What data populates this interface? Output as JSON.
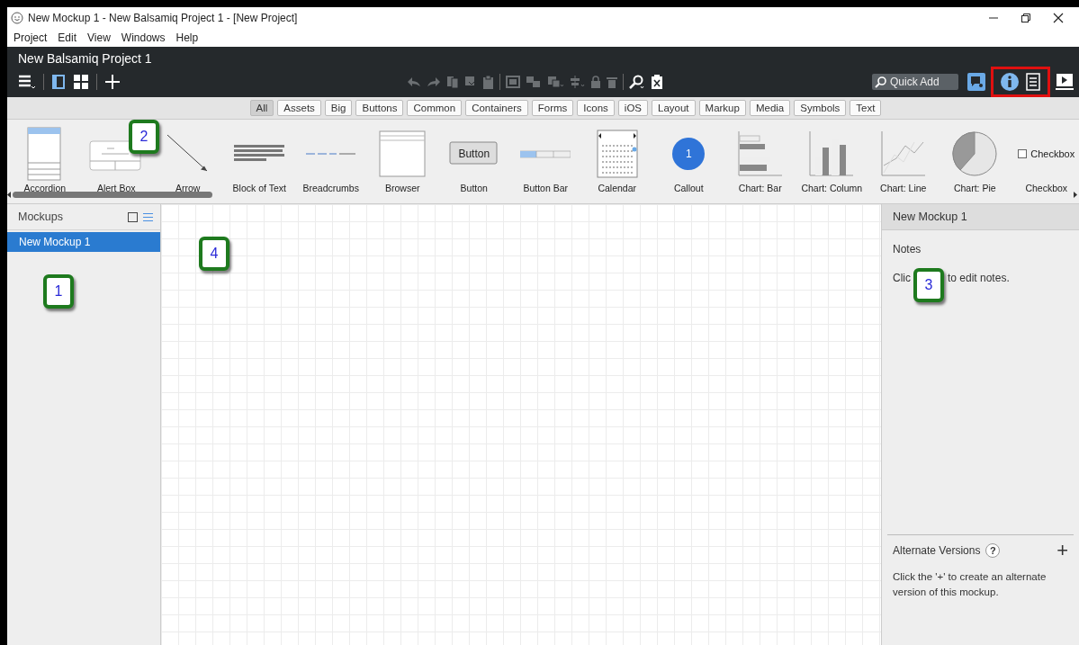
{
  "window": {
    "title": "New Mockup 1 - New Balsamiq Project 1 - [New Project]",
    "controls": [
      {
        "kind": "minimize"
      },
      {
        "kind": "restore"
      },
      {
        "kind": "close"
      }
    ]
  },
  "menu": [
    "Project",
    "Edit",
    "View",
    "Windows",
    "Help"
  ],
  "project_title": "New Balsamiq Project 1",
  "toolbar": {
    "left": [
      {
        "kind": "menu",
        "selected": false
      },
      {
        "kind": "single-pane",
        "selected": true
      },
      {
        "kind": "grid",
        "selected": false
      },
      {
        "kind": "add",
        "selected": false
      }
    ],
    "center": [
      {
        "kind": "undo",
        "disabled": true
      },
      {
        "kind": "redo",
        "disabled": true
      },
      {
        "kind": "copy",
        "disabled": true
      },
      {
        "kind": "cut",
        "disabled": true
      },
      {
        "kind": "paste",
        "disabled": true
      },
      {
        "kind": "group",
        "disabled": true
      },
      {
        "kind": "ungroup",
        "disabled": true
      },
      {
        "kind": "arrange",
        "disabled": true
      },
      {
        "kind": "align",
        "disabled": true
      },
      {
        "kind": "lock",
        "disabled": true
      },
      {
        "kind": "trash",
        "disabled": true
      },
      {
        "kind": "search",
        "disabled": false
      },
      {
        "kind": "clear",
        "disabled": false
      }
    ],
    "quick_add": {
      "placeholder": "Quick Add"
    },
    "right": [
      {
        "kind": "feedback",
        "selected": false
      },
      {
        "kind": "highlight-frame",
        "items": [
          {
            "kind": "info",
            "selected": true
          },
          {
            "kind": "notes",
            "selected": false
          }
        ]
      },
      {
        "kind": "present",
        "selected": false
      }
    ]
  },
  "filters": [
    {
      "label": "All",
      "selected": true
    },
    {
      "label": "Assets",
      "selected": false
    },
    {
      "label": "Big",
      "selected": false
    },
    {
      "label": "Buttons",
      "selected": false
    },
    {
      "label": "Common",
      "selected": false
    },
    {
      "label": "Containers",
      "selected": false
    },
    {
      "label": "Forms",
      "selected": false
    },
    {
      "label": "Icons",
      "selected": false
    },
    {
      "label": "iOS",
      "selected": false
    },
    {
      "label": "Layout",
      "selected": false
    },
    {
      "label": "Markup",
      "selected": false
    },
    {
      "label": "Media",
      "selected": false
    },
    {
      "label": "Symbols",
      "selected": false
    },
    {
      "label": "Text",
      "selected": false
    }
  ],
  "library": [
    {
      "label": "Accordion",
      "kind": "accordion"
    },
    {
      "label": "Alert Box",
      "kind": "alert"
    },
    {
      "label": "Arrow",
      "kind": "arrow"
    },
    {
      "label": "Block of Text",
      "kind": "text-block"
    },
    {
      "label": "Breadcrumbs",
      "kind": "breadcrumbs"
    },
    {
      "label": "Browser",
      "kind": "browser"
    },
    {
      "label": "Button",
      "kind": "button",
      "text": "Button"
    },
    {
      "label": "Button Bar",
      "kind": "button-bar"
    },
    {
      "label": "Calendar",
      "kind": "calendar"
    },
    {
      "label": "Callout",
      "kind": "callout",
      "text": "1"
    },
    {
      "label": "Chart: Bar",
      "kind": "bar-chart"
    },
    {
      "label": "Chart: Column",
      "kind": "column-chart"
    },
    {
      "label": "Chart: Line",
      "kind": "line-chart"
    },
    {
      "label": "Chart: Pie",
      "kind": "pie-chart"
    },
    {
      "label": "Checkbox",
      "kind": "checkbox",
      "text": "Checkbox"
    }
  ],
  "mockups_panel": {
    "title": "Mockups",
    "items": [
      {
        "label": "New Mockup 1",
        "selected": true
      }
    ]
  },
  "inspector": {
    "title": "New Mockup 1",
    "notes_label": "Notes",
    "notes_hint": [
      "Clic",
      "to edit notes."
    ],
    "alternate_versions": {
      "title": "Alternate Versions",
      "help": "?",
      "add": "+",
      "hint": "Click the '+' to create an alternate version of this mockup."
    }
  },
  "annotations": {
    "mockups": "1",
    "library": "2",
    "inspector": "3",
    "canvas": "4"
  }
}
